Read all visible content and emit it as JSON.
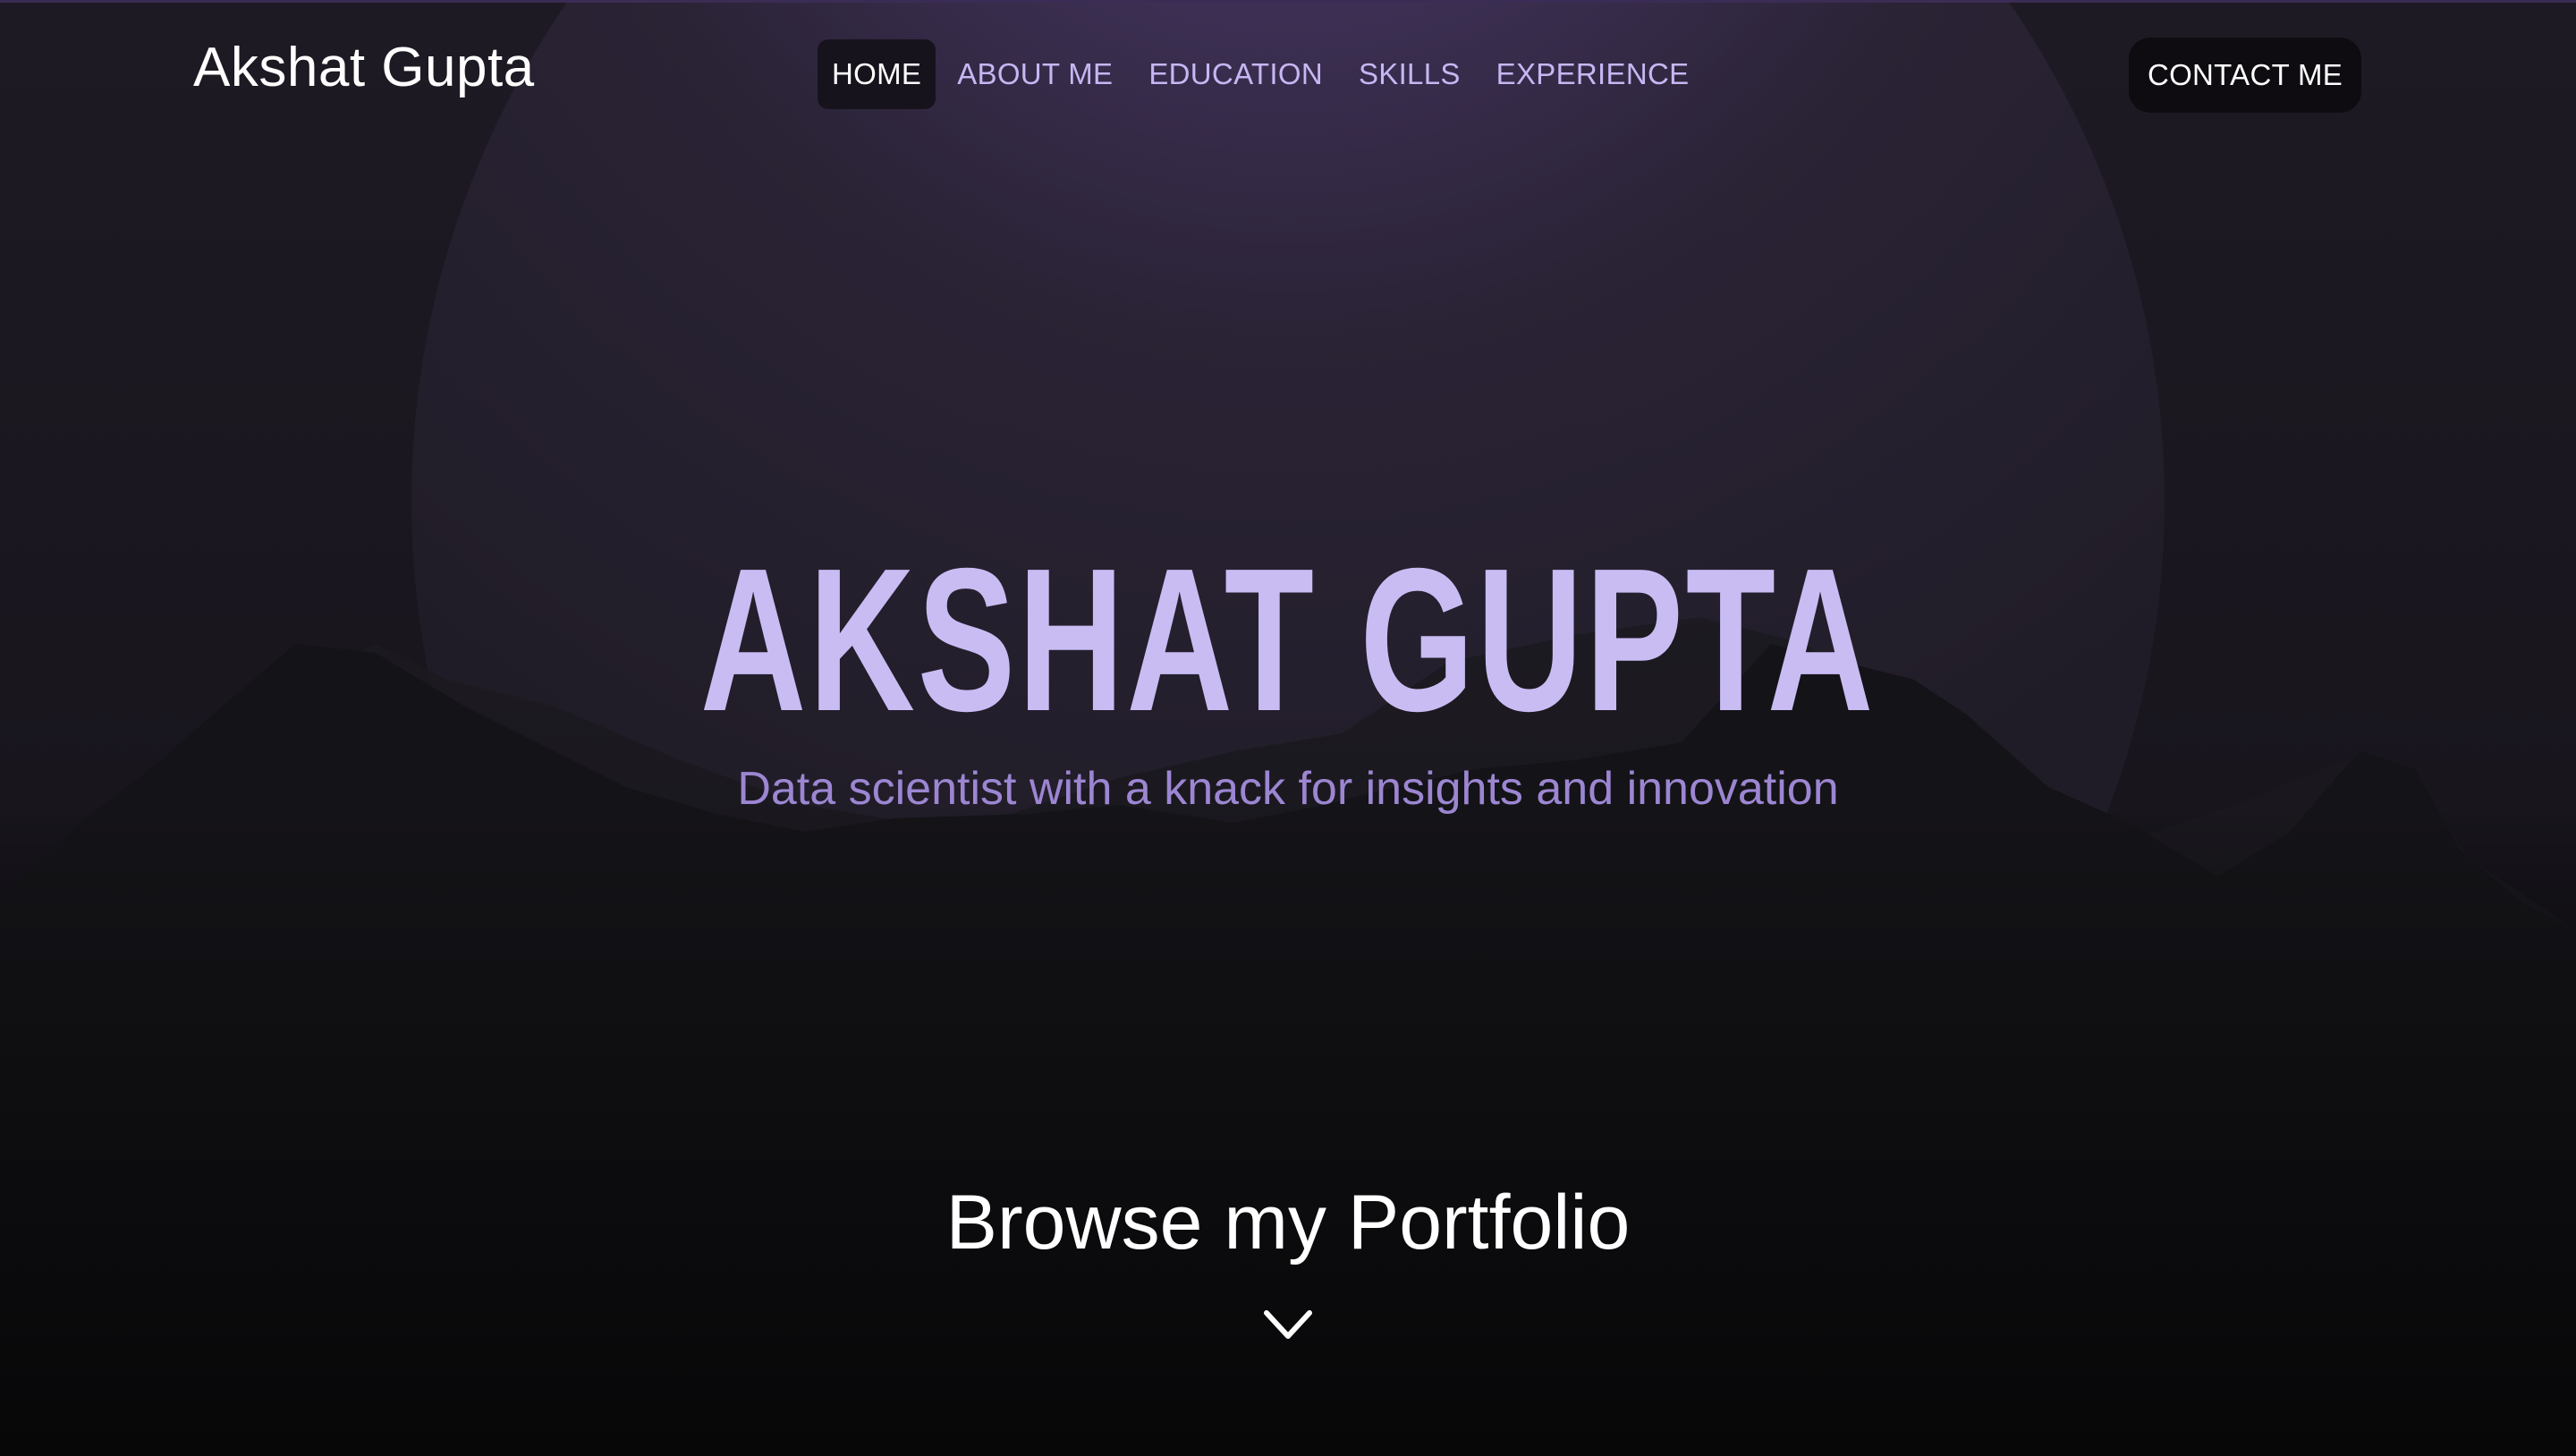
{
  "nav": {
    "brand": "Akshat Gupta",
    "items": [
      {
        "label": "HOME",
        "active": true
      },
      {
        "label": "ABOUT ME",
        "active": false
      },
      {
        "label": "EDUCATION",
        "active": false
      },
      {
        "label": "SKILLS",
        "active": false
      },
      {
        "label": "EXPERIENCE",
        "active": false
      }
    ],
    "contact_label": "CONTACT ME"
  },
  "hero": {
    "title": "AKSHAT GUPTA",
    "subtitle": "Data scientist with a knack for insights and innovation"
  },
  "browse": {
    "label": "Browse my Portfolio",
    "icon": "chevron-down-icon"
  },
  "colors": {
    "accent": "#c9bcf3",
    "subtitle": "#9c86d2",
    "nav_link": "#c6b6f2",
    "background": "#070708"
  }
}
